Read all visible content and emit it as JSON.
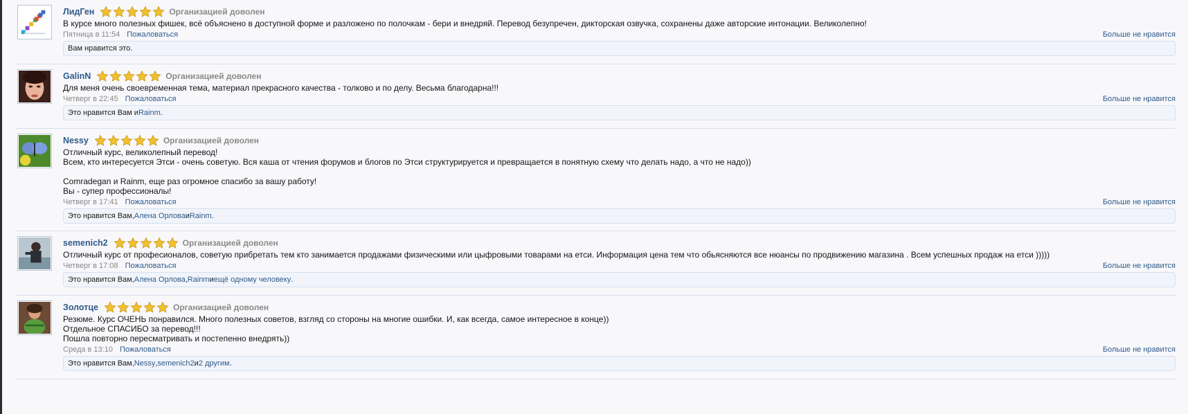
{
  "colors": {
    "accent_link": "#2f5a8a",
    "muted": "#888888",
    "star": "#f0c030",
    "likes_bg": "#f1f5fb"
  },
  "icons": {
    "rating_star": "star-icon"
  },
  "reviews": [
    {
      "username": "ЛидГен",
      "stars": 5,
      "rating_text": "Организацией доволен",
      "text_lines": [
        "В курсе много полезных фишек, всё объяснено в доступной форме и разложено по полочкам - бери и внедряй. Перевод безупречен, дикторская озвучка, сохранены даже авторские интонации. Великолепно!"
      ],
      "date": "Пятница в 11:54",
      "report": "Пожаловаться",
      "unlike": "Больше не нравится",
      "likes": {
        "prefix": "Вам нравится это.",
        "links": [],
        "mid": "",
        "suffix": ""
      }
    },
    {
      "username": "GalinN",
      "stars": 5,
      "rating_text": "Организацией доволен",
      "text_lines": [
        "Для меня очень своевременная тема, материал прекрасного качества - толково и по делу. Весьма благодарна!!!"
      ],
      "date": "Четверг в 22:45",
      "report": "Пожаловаться",
      "unlike": "Больше не нравится",
      "likes": {
        "prefix": "Это нравится Вам и ",
        "links": [
          "Rainm"
        ],
        "suffix": "."
      }
    },
    {
      "username": "Nessy",
      "stars": 5,
      "rating_text": "Организацией доволен",
      "text_lines": [
        "Отличный курс, великолепный перевод!",
        "Всем, кто интересуется Этси - очень советую. Вся каша от чтения форумов и блогов по Этси структурируется и превращается в понятную схему что делать надо, а что не надо))",
        "",
        "Comradegan и Rainm, еще раз огромное спасибо за вашу работу!",
        "Вы - супер профессионалы!"
      ],
      "date": "Четверг в 17:41",
      "report": "Пожаловаться",
      "unlike": "Больше не нравится",
      "likes": {
        "prefix": "Это нравится Вам, ",
        "links": [
          "Алена Орлова",
          "Rainm"
        ],
        "suffix": "."
      }
    },
    {
      "username": "semenich2",
      "stars": 5,
      "rating_text": "Организацией доволен",
      "text_lines": [
        "Отличный курс от професионалов, советую прибретать тем кто занимается продажами физическими или цыфровыми товарами на етси. Информация цена тем что обьясняются все нюансы по продвижению магазина . Всем успешных продаж на етси )))))"
      ],
      "date": "Четверг в 17:08",
      "report": "Пожаловаться",
      "unlike": "Больше не нравится",
      "likes": {
        "prefix": "Это нравится Вам, ",
        "links": [
          "Алена Орлова",
          "Rainm",
          "ещё одному человеку"
        ],
        "suffix": "."
      }
    },
    {
      "username": "Золотце",
      "stars": 5,
      "rating_text": "Организацией доволен",
      "text_lines": [
        "Резюме. Курс ОЧЕНЬ понравился. Много полезных советов, взгляд со стороны на многие ошибки. И, как всегда, самое интересное в конце))",
        "Отдельное СПАСИБО за перевод!!!",
        "Пошла повторно пересматривать и постепенно внедрять))"
      ],
      "date": "Среда в 13:10",
      "report": "Пожаловаться",
      "unlike": "Больше не нравится",
      "likes": {
        "prefix": "Это нравится Вам, ",
        "links": [
          "Nessy",
          "semenich2",
          "2 другим"
        ],
        "suffix": "."
      }
    }
  ]
}
